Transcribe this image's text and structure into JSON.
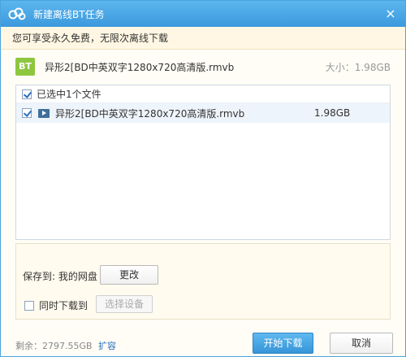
{
  "window": {
    "title": "新建离线BT任务",
    "close_icon": "×"
  },
  "notice": {
    "text": "您可享受永久免费，无限次离线下载"
  },
  "file": {
    "badge": "BT",
    "name": "异形2[BD中英双字1280x720高清版.rmvb",
    "size_label": "大小：1.98GB"
  },
  "file_list": {
    "select_all_label": "已选中1个文件",
    "select_all_checked": true,
    "rows": [
      {
        "name": "异形2[BD中英双字1280x720高清版.rmvb",
        "size": "1.98GB",
        "checked": true
      }
    ]
  },
  "save": {
    "label": "保存到: 我的网盘",
    "change_label": "更改",
    "sync_label": "同时下载到",
    "sync_checked": false,
    "device_label": "选择设备"
  },
  "footer": {
    "remaining": "剩余：2797.55GB",
    "expand_label": "扩容",
    "start_label": "开始下载",
    "cancel_label": "取消"
  },
  "colors": {
    "title_bar": "#3b99dd",
    "bt_badge": "#8ec63f",
    "accent": "#2a6ebb"
  },
  "icons": {
    "title_logo": "cloud-link-icon",
    "close": "close-icon",
    "bt": "bt-file-icon",
    "video": "video-file-icon"
  }
}
